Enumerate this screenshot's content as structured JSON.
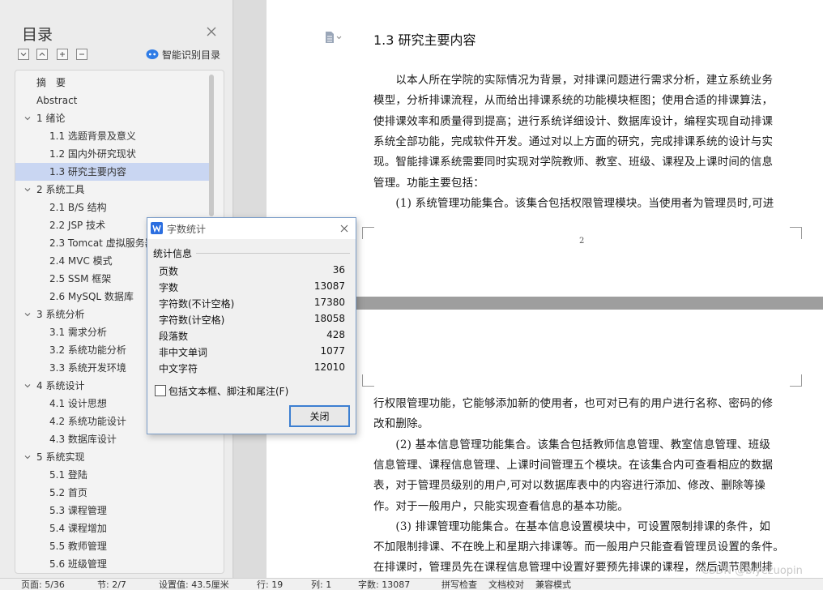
{
  "toc": {
    "title": "目录",
    "smart_label": "智能识别目录",
    "items": [
      {
        "label": "摘　要",
        "level": 0,
        "expandable": false,
        "selected": false
      },
      {
        "label": "Abstract",
        "level": 0,
        "expandable": false,
        "selected": false
      },
      {
        "label": "1 绪论",
        "level": 1,
        "expandable": true,
        "selected": false
      },
      {
        "label": "1.1 选题背景及意义",
        "level": 2,
        "expandable": false,
        "selected": false
      },
      {
        "label": "1.2 国内外研究现状",
        "level": 2,
        "expandable": false,
        "selected": false
      },
      {
        "label": "1.3 研究主要内容",
        "level": 2,
        "expandable": false,
        "selected": true
      },
      {
        "label": "2 系统工具",
        "level": 1,
        "expandable": true,
        "selected": false
      },
      {
        "label": "2.1 B/S 结构",
        "level": 2,
        "expandable": false,
        "selected": false
      },
      {
        "label": "2.2 JSP 技术",
        "level": 2,
        "expandable": false,
        "selected": false
      },
      {
        "label": "2.3 Tomcat 虚拟服务器",
        "level": 2,
        "expandable": false,
        "selected": false
      },
      {
        "label": "2.4 MVC 模式",
        "level": 2,
        "expandable": false,
        "selected": false
      },
      {
        "label": "2.5 SSM 框架",
        "level": 2,
        "expandable": false,
        "selected": false
      },
      {
        "label": "2.6 MySQL 数据库",
        "level": 2,
        "expandable": false,
        "selected": false
      },
      {
        "label": "3 系统分析",
        "level": 1,
        "expandable": true,
        "selected": false
      },
      {
        "label": "3.1 需求分析",
        "level": 2,
        "expandable": false,
        "selected": false
      },
      {
        "label": "3.2 系统功能分析",
        "level": 2,
        "expandable": false,
        "selected": false
      },
      {
        "label": "3.3 系统开发环境",
        "level": 2,
        "expandable": false,
        "selected": false
      },
      {
        "label": "4 系统设计",
        "level": 1,
        "expandable": true,
        "selected": false
      },
      {
        "label": "4.1 设计思想",
        "level": 2,
        "expandable": false,
        "selected": false
      },
      {
        "label": "4.2 系统功能设计",
        "level": 2,
        "expandable": false,
        "selected": false
      },
      {
        "label": "4.3 数据库设计",
        "level": 2,
        "expandable": false,
        "selected": false
      },
      {
        "label": "5 系统实现",
        "level": 1,
        "expandable": true,
        "selected": false
      },
      {
        "label": "5.1 登陆",
        "level": 2,
        "expandable": false,
        "selected": false
      },
      {
        "label": "5.2 首页",
        "level": 2,
        "expandable": false,
        "selected": false
      },
      {
        "label": "5.3 课程管理",
        "level": 2,
        "expandable": false,
        "selected": false
      },
      {
        "label": "5.4 课程增加",
        "level": 2,
        "expandable": false,
        "selected": false
      },
      {
        "label": "5.5 教师管理",
        "level": 2,
        "expandable": false,
        "selected": false
      },
      {
        "label": "5.6 班级管理",
        "level": 2,
        "expandable": false,
        "selected": false
      }
    ]
  },
  "document": {
    "heading": "1.3 研究主要内容",
    "page_number": "2",
    "page1_lines": [
      "　　以本人所在学院的实际情况为背景，对排课问题进行需求分析，建立系统业务",
      "模型，分析排课流程，从而给出排课系统的功能模块框图；使用合适的排课算法，",
      "使排课效率和质量得到提高；进行系统详细设计、数据库设计，编程实现自动排课",
      "系统全部功能，完成软件开发。通过对以上方面的研究，完成排课系统的设计与实",
      "现。智能排课系统需要同时实现对学院教师、教室、班级、课程及上课时间的信息",
      "管理。功能主要包括：",
      "　　(1) 系统管理功能集合。该集合包括权限管理模块。当使用者为管理员时,可进"
    ],
    "page2_lines": [
      "行权限管理功能，它能够添加新的使用者，也可对已有的用户进行名称、密码的修",
      "改和删除。",
      "　　(2) 基本信息管理功能集合。该集合包括教师信息管理、教室信息管理、班级",
      "信息管理、课程信息管理、上课时间管理五个模块。在该集合内可查看相应的数据",
      "表，对于管理员级别的用户,可对以数据库表中的内容进行添加、修改、删除等操",
      "作。对于一般用户，只能实现查看信息的基本功能。",
      "　　(3) 排课管理功能集合。在基本信息设置模块中，可设置限制排课的条件，如",
      "不加限制排课、不在晚上和星期六排课等。而一般用户只能查看管理员设置的条件。",
      "在排课时，管理员先在课程信息管理中设置好要预先排课的课程，然后调节限制排"
    ]
  },
  "dialog": {
    "title": "字数统计",
    "group_label": "统计信息",
    "stats": [
      {
        "label": "页数",
        "value": "36"
      },
      {
        "label": "字数",
        "value": "13087"
      },
      {
        "label": "字符数(不计空格)",
        "value": "17380"
      },
      {
        "label": "字符数(计空格)",
        "value": "18058"
      },
      {
        "label": "段落数",
        "value": "428"
      },
      {
        "label": "非中文单词",
        "value": "1077"
      },
      {
        "label": "中文字符",
        "value": "12010"
      }
    ],
    "checkbox_label": "包括文本框、脚注和尾注(F)",
    "checkbox_checked": false,
    "close_button": "关闭"
  },
  "statusbar": {
    "items": [
      "页面: 5/36",
      "节: 2/7",
      "设置值: 43.5厘米",
      "行: 19",
      "列: 1",
      "字数: 13087",
      "拼写检查",
      "文档校对",
      "兼容模式"
    ]
  },
  "watermark": "CSDN @biyezuopin",
  "colors": {
    "selection": "#c9d6f2",
    "dialog_icon": "#2b6ee0",
    "button_border": "#3c7fd1"
  }
}
